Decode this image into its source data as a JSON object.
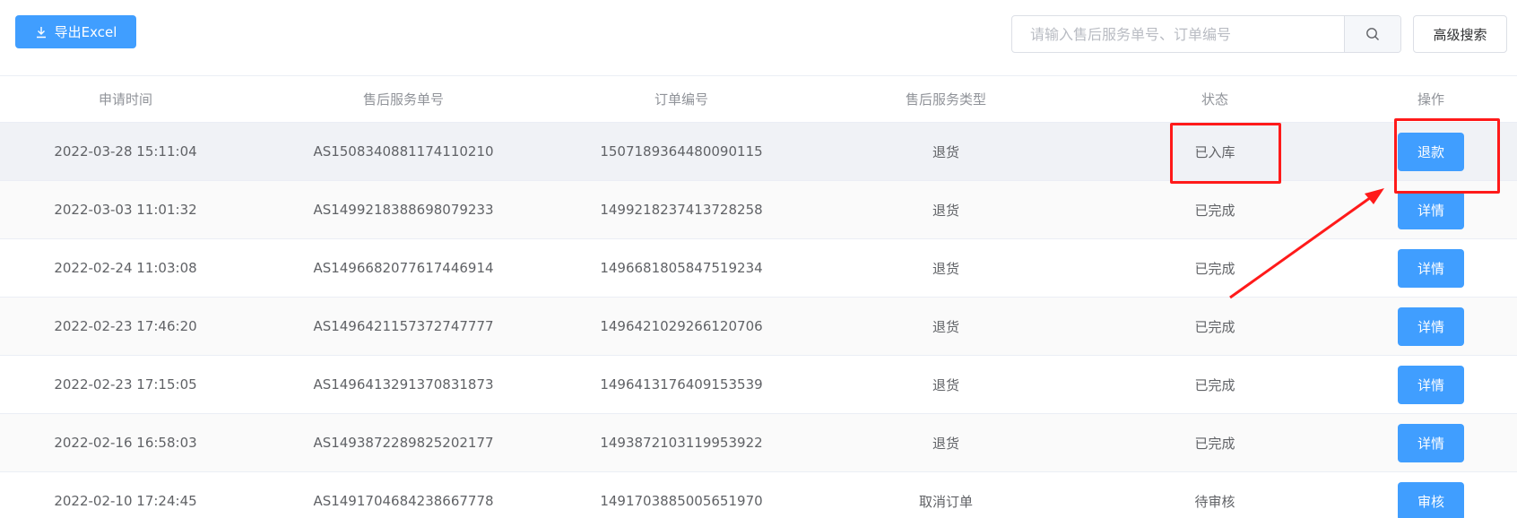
{
  "toolbar": {
    "export_label": "导出Excel",
    "search_placeholder": "请输入售后服务单号、订单编号",
    "search_value": "",
    "advanced_search_label": "高级搜索"
  },
  "table": {
    "headers": {
      "apply_time": "申请时间",
      "service_no": "售后服务单号",
      "order_no": "订单编号",
      "service_type": "售后服务类型",
      "status": "状态",
      "actions": "操作"
    },
    "rows": [
      {
        "apply_time": "2022-03-28 15:11:04",
        "service_no": "AS1508340881174110210",
        "order_no": "1507189364480090115",
        "service_type": "退货",
        "status": "已入库",
        "action": "退款"
      },
      {
        "apply_time": "2022-03-03 11:01:32",
        "service_no": "AS1499218388698079233",
        "order_no": "1499218237413728258",
        "service_type": "退货",
        "status": "已完成",
        "action": "详情"
      },
      {
        "apply_time": "2022-02-24 11:03:08",
        "service_no": "AS1496682077617446914",
        "order_no": "1496681805847519234",
        "service_type": "退货",
        "status": "已完成",
        "action": "详情"
      },
      {
        "apply_time": "2022-02-23 17:46:20",
        "service_no": "AS1496421157372747777",
        "order_no": "1496421029266120706",
        "service_type": "退货",
        "status": "已完成",
        "action": "详情"
      },
      {
        "apply_time": "2022-02-23 17:15:05",
        "service_no": "AS1496413291370831873",
        "order_no": "1496413176409153539",
        "service_type": "退货",
        "status": "已完成",
        "action": "详情"
      },
      {
        "apply_time": "2022-02-16 16:58:03",
        "service_no": "AS1493872289825202177",
        "order_no": "1493872103119953922",
        "service_type": "退货",
        "status": "已完成",
        "action": "详情"
      },
      {
        "apply_time": "2022-02-10 17:24:45",
        "service_no": "AS1491704684238667778",
        "order_no": "1491703885005651970",
        "service_type": "取消订单",
        "status": "待审核",
        "action": "审核"
      }
    ]
  },
  "annotations": {
    "highlight_color": "#ff1a1a",
    "primary_color": "#409eff"
  }
}
